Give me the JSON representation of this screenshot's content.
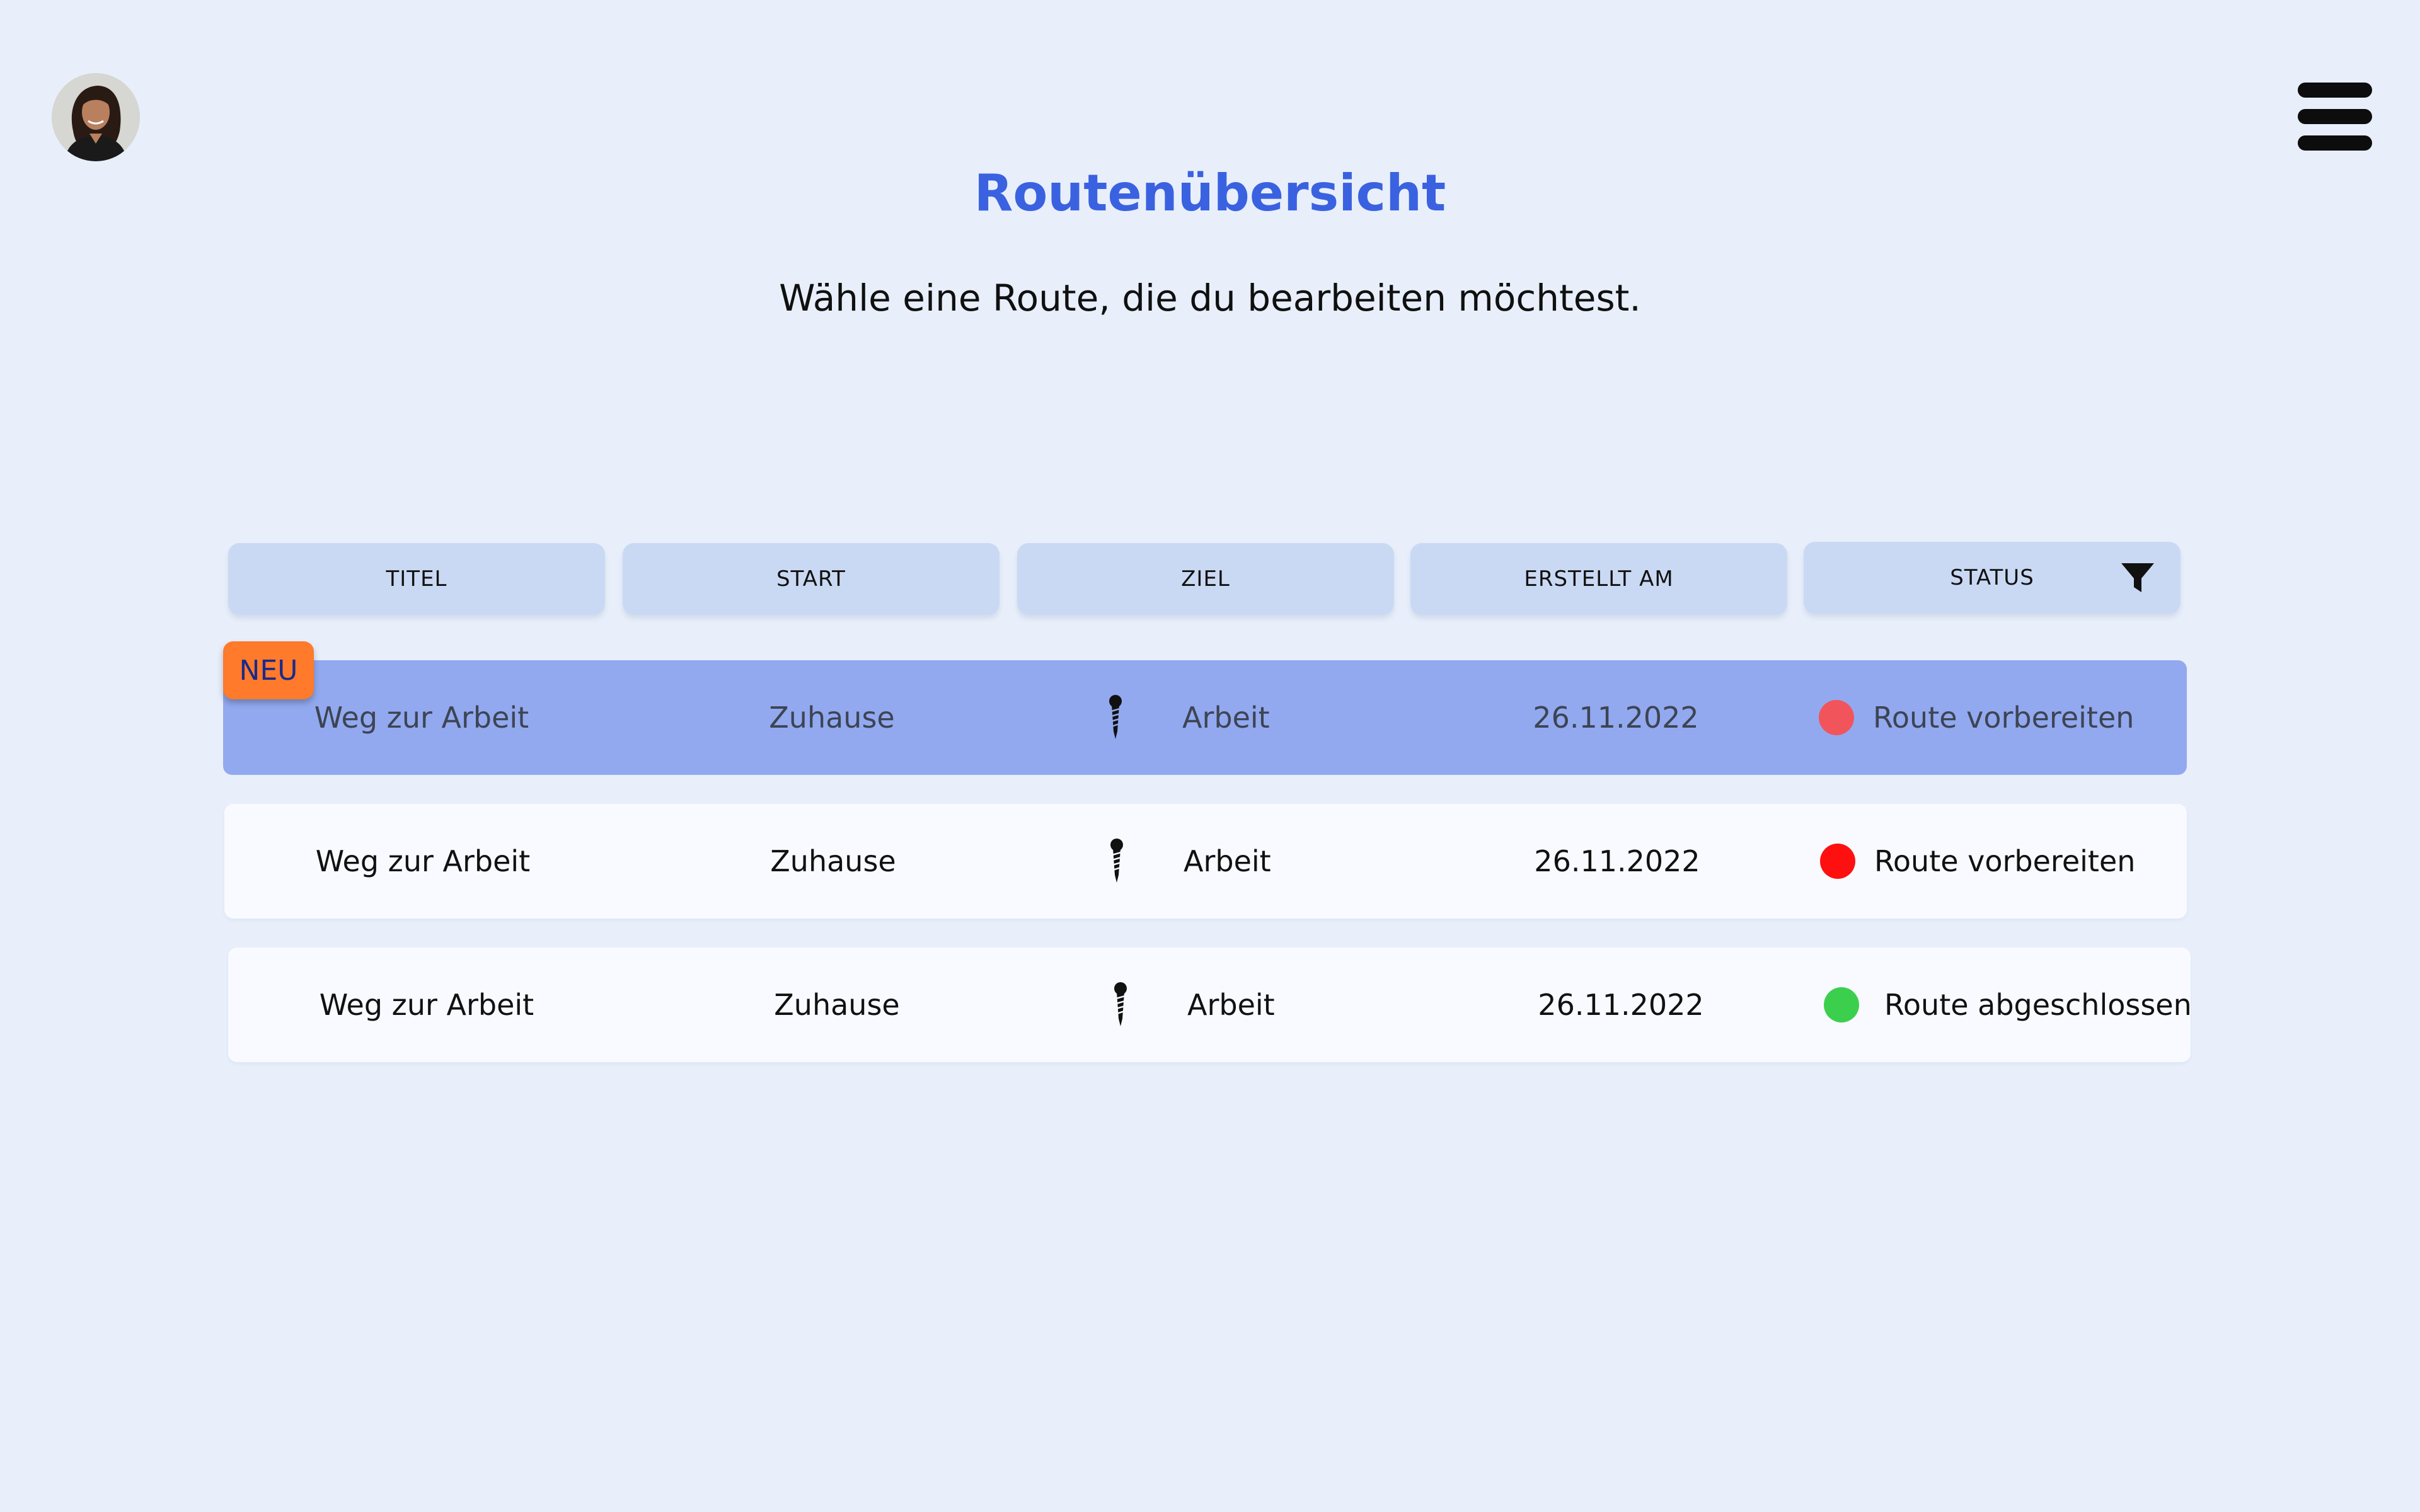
{
  "header": {
    "title": "Routenübersicht",
    "subtitle": "Wähle eine Route, die du bearbeiten möchtest.",
    "avatar_icon": "user-avatar",
    "menu_icon": "hamburger-menu-icon"
  },
  "table": {
    "columns": [
      {
        "label": "TITEL"
      },
      {
        "label": "START"
      },
      {
        "label": "ZIEL"
      },
      {
        "label": "ERSTELLT AM"
      },
      {
        "label": "STATUS",
        "icon": "filter-icon"
      }
    ],
    "new_badge": "NEU",
    "rows": [
      {
        "title": "Weg zur Arbeit",
        "start": "Zuhause",
        "destination_icon": "pin-icon",
        "destination": "Arbeit",
        "created": "26.11.2022",
        "status": "Route vorbereiten",
        "status_color": "#f2545b",
        "selected": true
      },
      {
        "title": "Weg zur Arbeit",
        "start": "Zuhause",
        "destination_icon": "pin-icon",
        "destination": "Arbeit",
        "created": "26.11.2022",
        "status": "Route vorbereiten",
        "status_color": "#ff1010",
        "selected": false
      },
      {
        "title": "Weg zur Arbeit",
        "start": "Zuhause",
        "destination_icon": "pin-icon",
        "destination": "Arbeit",
        "created": "26.11.2022",
        "status": "Route abgeschlossen",
        "status_color": "#3ccf4e",
        "selected": false
      }
    ]
  },
  "colors": {
    "background": "#e8effb",
    "accent": "#3a62e0",
    "header_cell": "#cad9f3",
    "selected_row": "#92a9f0",
    "badge": "#ff7a2a"
  }
}
